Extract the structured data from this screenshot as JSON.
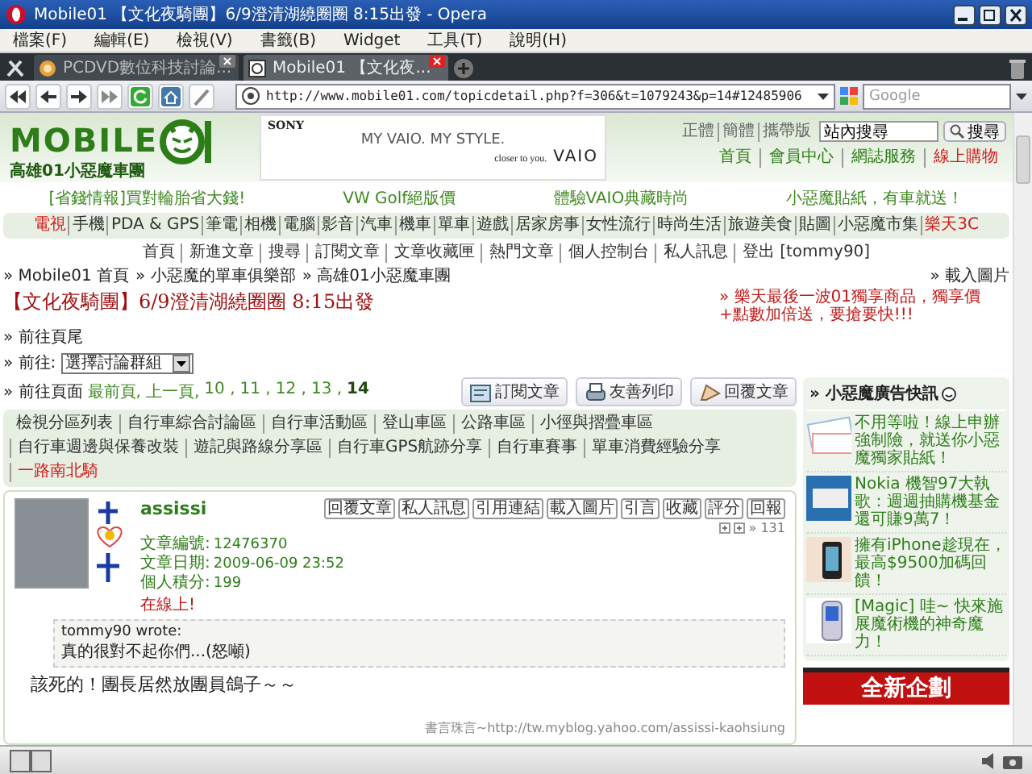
{
  "window": {
    "title": "Mobile01 【文化夜騎團】6/9澄清湖繞圈圈 8:15出發 - Opera"
  },
  "menu": [
    "檔案(F)",
    "編輯(E)",
    "檢視(V)",
    "書籤(B)",
    "Widget",
    "工具(T)",
    "說明(H)"
  ],
  "tabs": [
    {
      "label": "PCDVD數位科技討論...",
      "selected": false
    },
    {
      "label": "Mobile01 【文化夜...",
      "selected": true
    }
  ],
  "address_bar": {
    "url": "http://www.mobile01.com/topicdetail.php?f=306&t=1079243&p=14#12485906"
  },
  "search_field": {
    "placeholder": "Google"
  },
  "page": {
    "logo": {
      "wordmark": "MOBILE",
      "tagline": "高雄01小惡魔車團"
    },
    "banner_ad": {
      "brand": "SONY",
      "headline": "MY VAIO. MY STYLE.",
      "slogan": "closer to you.",
      "logo": "VAIO"
    },
    "language_links": [
      "正體",
      "簡體",
      "攜帶版"
    ],
    "site_search": {
      "value": "站內搜尋",
      "button": "搜尋"
    },
    "top_nav": [
      {
        "label": "首頁",
        "highlight": false
      },
      {
        "label": "會員中心",
        "highlight": false
      },
      {
        "label": "網誌服務",
        "highlight": false
      },
      {
        "label": "線上購物",
        "highlight": true
      }
    ],
    "promo_links": [
      "[省錢情報]買對輪胎省大錢!",
      "VW Golf絕版價",
      "體驗VAIO典藏時尚",
      "小惡魔貼紙，有車就送！"
    ],
    "categories": [
      {
        "label": "電視",
        "highlight": true
      },
      {
        "label": "手機",
        "highlight": false
      },
      {
        "label": "PDA & GPS",
        "highlight": false
      },
      {
        "label": "筆電",
        "highlight": false
      },
      {
        "label": "相機",
        "highlight": false
      },
      {
        "label": "電腦",
        "highlight": false
      },
      {
        "label": "影音",
        "highlight": false
      },
      {
        "label": "汽車",
        "highlight": false
      },
      {
        "label": "機車",
        "highlight": false
      },
      {
        "label": "單車",
        "highlight": false
      },
      {
        "label": "遊戲",
        "highlight": false
      },
      {
        "label": "居家房事",
        "highlight": false
      },
      {
        "label": "女性流行",
        "highlight": false
      },
      {
        "label": "時尚生活",
        "highlight": false
      },
      {
        "label": "旅遊美食",
        "highlight": false
      },
      {
        "label": "貼圖",
        "highlight": false
      },
      {
        "label": "小惡魔市集",
        "highlight": false
      },
      {
        "label": "樂天3C",
        "highlight": true
      }
    ],
    "member_nav": [
      "首頁",
      "新進文章",
      "搜尋",
      "訂閱文章",
      "文章收藏匣",
      "熱門文章",
      "個人控制台",
      "私人訊息",
      "登出 [tommy90]"
    ],
    "breadcrumb": [
      "» Mobile01 首頁",
      "» 小惡魔的單車俱樂部",
      "» 高雄01小惡魔車團"
    ],
    "load_images": "» 載入圖片",
    "topic_title": "【文化夜騎團】6/9澄清湖繞圈圈 8:15出發",
    "announcement": "» 樂天最後一波01獨享商品，獨享價+點數加倍送，要搶要快!!!",
    "go_bottom": "» 前往頁尾",
    "goto": {
      "label": "» 前往:",
      "select": "選擇討論群組"
    },
    "pager": {
      "label": "» 前往頁面",
      "links": [
        {
          "label": "最前頁,",
          "selected": false
        },
        {
          "label": "上一頁,",
          "selected": false
        },
        {
          "label": "10 ,",
          "selected": false
        },
        {
          "label": "11 ,",
          "selected": false
        },
        {
          "label": "12 ,",
          "selected": false
        },
        {
          "label": "13 ,",
          "selected": false
        },
        {
          "label": "14",
          "selected": true
        }
      ]
    },
    "topic_actions": [
      {
        "label": "訂閱文章",
        "kind": "subscribe"
      },
      {
        "label": "友善列印",
        "kind": "print"
      },
      {
        "label": "回覆文章",
        "kind": "reply"
      }
    ],
    "forums": [
      {
        "label": "檢視分區列表",
        "highlight": false
      },
      {
        "label": "自行車綜合討論區",
        "highlight": false
      },
      {
        "label": "自行車活動區",
        "highlight": false
      },
      {
        "label": "登山車區",
        "highlight": false
      },
      {
        "label": "公路車區",
        "highlight": false
      },
      {
        "label": "小徑與摺疊車區",
        "highlight": false
      },
      {
        "label": "自行車週邊與保養改裝",
        "highlight": false
      },
      {
        "label": "遊記與路線分享區",
        "highlight": false
      },
      {
        "label": "自行車GPS航跡分享",
        "highlight": false
      },
      {
        "label": "自行車賽事",
        "highlight": false
      },
      {
        "label": "單車消費經驗分享",
        "highlight": false
      },
      {
        "label": "一路南北騎",
        "highlight": true
      }
    ],
    "post": {
      "author": "assissi",
      "actions": [
        "回覆文章",
        "私人訊息",
        "引用連結",
        "載入圖片",
        "引言",
        "收藏",
        "評分",
        "回報"
      ],
      "floor": "» 131",
      "info": [
        {
          "label": "文章編號:",
          "value": "12476370"
        },
        {
          "label": "文章日期:",
          "value": "2009-06-09 23:52"
        },
        {
          "label": "個人積分:",
          "value": "199"
        }
      ],
      "online": "在線上!",
      "quote": {
        "author_line": "tommy90 wrote:",
        "text": "真的很對不起你們...(怒噸)"
      },
      "body": "該死的！團長居然放團員鴿子～～",
      "signature": "書言珠言~http://tw.myblog.yahoo.com/assissi-kaohsiung"
    },
    "sidebar": {
      "title": "» 小惡魔廣告快訊",
      "items": [
        {
          "text": "不用等啦！線上申辦強制險，就送你小惡魔獨家貼紙！",
          "kind": "cards"
        },
        {
          "text": "Nokia 機智97大執歌：週週抽購機基金還可賺9萬7！",
          "kind": "laptop"
        },
        {
          "text": "擁有iPhone趁現在，最高$9500加碼回饋！",
          "kind": "phone"
        },
        {
          "text": "[Magic] 哇~ 快來施展魔術機的神奇魔力！",
          "kind": "handset"
        }
      ],
      "banner": "全新企劃"
    }
  }
}
